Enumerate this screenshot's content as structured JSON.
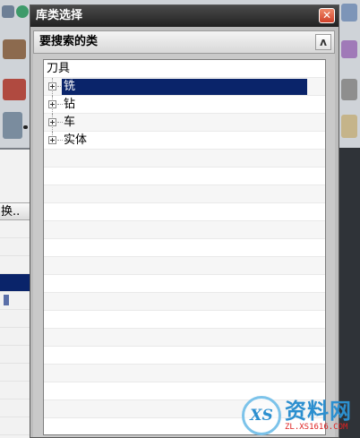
{
  "dialog": {
    "title": "库类选择",
    "close_glyph": "✕",
    "group_title": "要搜索的类",
    "collapse_glyph": "ʌ"
  },
  "tree": {
    "root_label": "刀具",
    "items": [
      {
        "label": "铣",
        "selected": true
      },
      {
        "label": "钻",
        "selected": false
      },
      {
        "label": "车",
        "selected": false
      },
      {
        "label": "实体",
        "selected": false
      }
    ]
  },
  "background": {
    "column_header": "换.."
  },
  "watermark": {
    "brand_text": "资料网",
    "url_text": "ZL.XS1616.COM",
    "logo_text": "XS"
  },
  "colors": {
    "selection": "#0a246a",
    "titlebar": "#2a2a2a",
    "close": "#d0412a"
  }
}
